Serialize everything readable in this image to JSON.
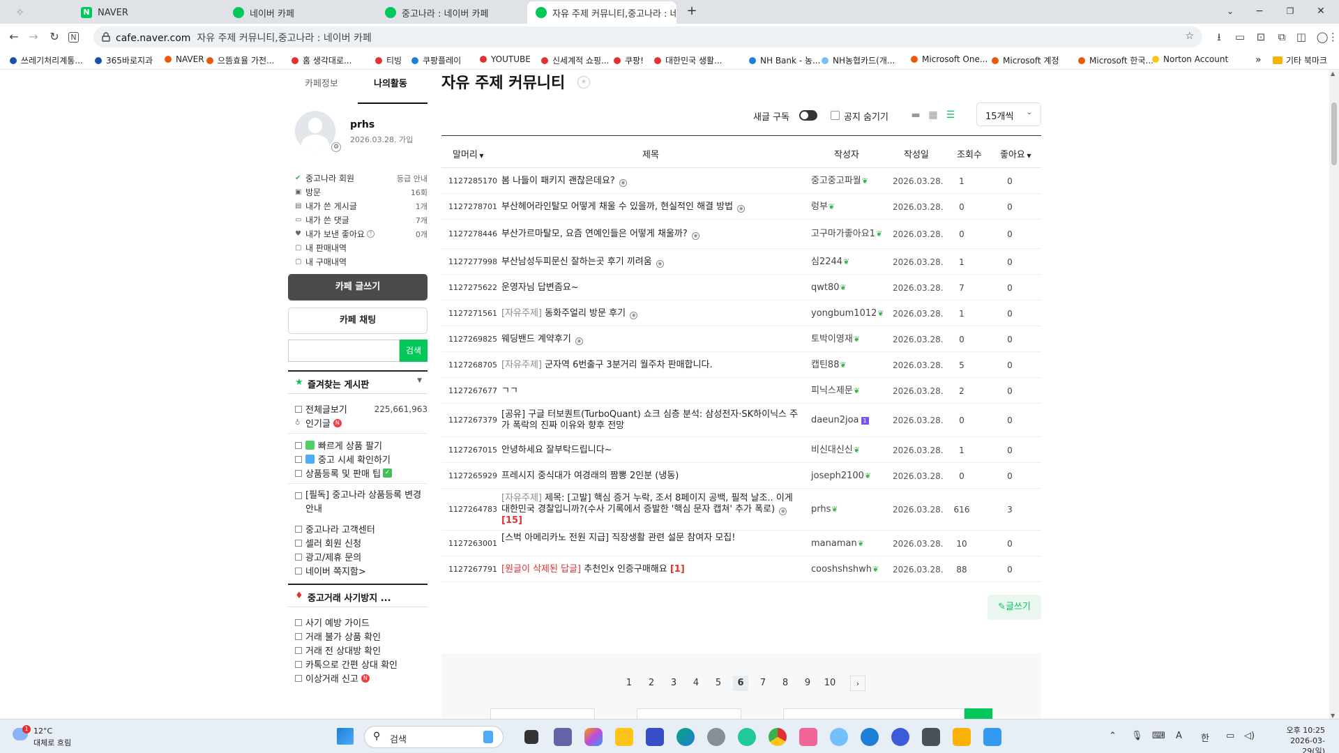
{
  "browser": {
    "tabs": [
      {
        "label": "NAVER",
        "favicon_color": "#03c75a",
        "favicon_letter": "N"
      },
      {
        "label": "네이버 카페",
        "favicon_color": "#03c75a",
        "favicon_letter": ""
      },
      {
        "label": "중고나라 : 네이버 카페",
        "favicon_color": "#03c75a",
        "favicon_letter": ""
      },
      {
        "label": "자유 주제 커뮤니티,중고나라 : 네",
        "favicon_color": "#03c75a",
        "favicon_letter": ""
      }
    ],
    "new_tab": "+",
    "address": {
      "host": "cafe.naver.com",
      "rest": "자유 주제 커뮤니티,중고나라 : 네이버 카페"
    },
    "bookmarks": [
      {
        "label": "쓰레기처리계통...",
        "color": "#1c4fa8"
      },
      {
        "label": "365바로지과",
        "color": "#1c4fa8"
      },
      {
        "label": "NAVER",
        "color": "#e8590c"
      },
      {
        "label": "으뜸효율 가전...",
        "color": "#e8590c"
      },
      {
        "label": "홈 생각대로...",
        "color": "#e03131"
      },
      {
        "label": "티빙",
        "color": "#e03131"
      },
      {
        "label": "쿠팡플레이",
        "color": "#1c7ed6"
      },
      {
        "label": "YOUTUBE",
        "color": "#e03131"
      },
      {
        "label": "신세계적 쇼핑...",
        "color": "#e03131"
      },
      {
        "label": "쿠팡!",
        "color": "#e03131"
      },
      {
        "label": "대한민국 생활...",
        "color": "#e03131"
      },
      {
        "label": "NH Bank - 농...",
        "color": "#1c7ed6"
      },
      {
        "label": "NH농협카드(개...",
        "color": "#74c0fc"
      },
      {
        "label": "Microsoft One...",
        "color": "#e8590c"
      },
      {
        "label": "Microsoft 계정",
        "color": "#e8590c"
      },
      {
        "label": "Microsoft 한국...",
        "color": "#e8590c"
      },
      {
        "label": "Norton Account",
        "color": "#fcc419"
      }
    ],
    "bookmarks_more": "»",
    "other_bookmarks": "기타 북마크"
  },
  "sidebar": {
    "tab_info": "카페정보",
    "tab_activity": "나의활동",
    "profile": {
      "name": "prhs",
      "joined": "2026.03.28. 가입"
    },
    "member_label": "중고나라 회원",
    "grade_link": "등급 안내",
    "stats": [
      {
        "label": "방문",
        "value": "16회"
      },
      {
        "label": "내가 쓴 게시글",
        "value": "1개"
      },
      {
        "label": "내가 쓴 댓글",
        "value": "7개"
      },
      {
        "label": "내가 보낸 좋아요",
        "value": "0개"
      },
      {
        "label": "내 판매내역",
        "value": ""
      },
      {
        "label": "내 구매내역",
        "value": ""
      }
    ],
    "write_button": "카페 글쓰기",
    "chat_button": "카페 채팅",
    "search_button": "검색",
    "favorites_title": "즐겨찾는 게시판",
    "all_posts": "전체글보기",
    "all_posts_count": "225,661,963",
    "popular": "인기글",
    "menu_group1": [
      "빠르게 상품 팔기",
      "중고 시세 확인하기",
      "상품등록 및 판매 팁"
    ],
    "menu_group2": [
      "[필독] 중고나라 상품등록 변경안내",
      "중고나라 고객센터",
      "셀러 회원 신청",
      "광고/제휴 문의",
      "네이버 쪽지함>"
    ],
    "fraud_title": "중고거래 사기방지 ...",
    "fraud_items": [
      "사기 예방 가이드",
      "거래 불가 상품 확인",
      "거래 전 상대방 확인",
      "카톡으로 간편 상대 확인",
      "이상거래 신고"
    ]
  },
  "main": {
    "title": "자유 주제 커뮤니티",
    "subscribe_label": "새글 구독",
    "hide_notice_label": "공지 숨기기",
    "per_page": "15개씩",
    "columns": {
      "prefix": "말머리",
      "title": "제목",
      "author": "작성자",
      "date": "작성일",
      "views": "조회수",
      "likes": "좋아요"
    },
    "rows": [
      {
        "no": "1127285170",
        "head": "",
        "title": "봄 나들이 패키지 괜찮은데요?",
        "emo": true,
        "count": "",
        "author": "중고중고파월",
        "date": "2026.03.28.",
        "views": "1",
        "likes": "0"
      },
      {
        "no": "1127278701",
        "head": "",
        "title": "부산헤어라인탈모 어떻게 채울 수 있을까, 현실적인 해결 방법",
        "emo": true,
        "count": "",
        "author": "렁부",
        "date": "2026.03.28.",
        "views": "0",
        "likes": "0"
      },
      {
        "no": "1127278446",
        "head": "",
        "title": "부산가르마탈모, 요즘 연예인들은 어떻게 채울까?",
        "emo": true,
        "count": "",
        "author": "고구마가좋아요1",
        "date": "2026.03.28.",
        "views": "0",
        "likes": "0"
      },
      {
        "no": "1127277998",
        "head": "",
        "title": "부산남성두피문신 잘하는곳 후기 끼려움",
        "emo": true,
        "count": "",
        "author": "심2244",
        "date": "2026.03.28.",
        "views": "1",
        "likes": "0"
      },
      {
        "no": "1127275622",
        "head": "",
        "title": "운영자님 답변좀요~",
        "emo": false,
        "count": "",
        "author": "qwt80",
        "date": "2026.03.28.",
        "views": "7",
        "likes": "0"
      },
      {
        "no": "1127271561",
        "head": "[자유주제]",
        "title": "동화주얼리 방문 후기",
        "emo": true,
        "count": "",
        "author": "yongbum1012",
        "date": "2026.03.28.",
        "views": "1",
        "likes": "0"
      },
      {
        "no": "1127269825",
        "head": "",
        "title": "웨딩밴드 계약후기",
        "emo": true,
        "count": "",
        "author": "토박이영재",
        "date": "2026.03.28.",
        "views": "0",
        "likes": "0"
      },
      {
        "no": "1127268705",
        "head": "[자유주제]",
        "title": "군자역 6번출구 3분거리 월주차 판매합니다.",
        "emo": false,
        "count": "",
        "author": "캡틴88",
        "date": "2026.03.28.",
        "views": "5",
        "likes": "0"
      },
      {
        "no": "1127267677",
        "head": "",
        "title": "ㄱㄱ",
        "emo": false,
        "count": "",
        "author": "피닉스제문",
        "date": "2026.03.28.",
        "views": "2",
        "likes": "0"
      },
      {
        "no": "1127267379",
        "head": "",
        "title": "[공유] 구글 터보퀀트(TurboQuant) 쇼크 심층 분석: 삼성전자·SK하이닉스 주가 폭락의 진짜 이유와 향후 전망",
        "emo": false,
        "count": "",
        "author": "daeun2joa",
        "date": "2026.03.28.",
        "views": "0",
        "likes": "0"
      },
      {
        "no": "1127267015",
        "head": "",
        "title": "안녕하세요 잘부탁드립니다~",
        "emo": false,
        "count": "",
        "author": "비신대신신",
        "date": "2026.03.28.",
        "views": "1",
        "likes": "0"
      },
      {
        "no": "1127265929",
        "head": "",
        "title": "프레시지 중식대가 여경래의 짬뽕 2인분 (냉동)",
        "emo": false,
        "count": "",
        "author": "joseph2100",
        "date": "2026.03.28.",
        "views": "0",
        "likes": "0"
      },
      {
        "no": "1127264783",
        "head": "[자유주제]",
        "title": "제목: [고발] 핵심 증거 누락, 조서 8페이지 공백, 필적 날조.. 이게 대한민국 경찰입니까?(수사 기록에서 증발한 '핵심 문자 캡쳐' 추가 폭로)",
        "emo": true,
        "count": "[15]",
        "author": "prhs",
        "date": "2026.03.28.",
        "views": "616",
        "likes": "3"
      },
      {
        "no": "1127263001",
        "head": "",
        "title": "[스벅 아메리카노 전원 지급] 직장생활 관련 설문 참여자 모집!",
        "emo": false,
        "count": "",
        "author": "manaman",
        "date": "2026.03.28.",
        "views": "10",
        "likes": "0"
      },
      {
        "no": "1127267791",
        "head": "[원글이 삭제된 답글]",
        "title": "추천인x 인증구매해요",
        "emo": false,
        "count": "[1]",
        "author": "cooshshshwh",
        "date": "2026.03.28.",
        "views": "88",
        "likes": "0"
      }
    ],
    "write_button": "✎글쓰기",
    "pages": [
      "1",
      "2",
      "3",
      "4",
      "5",
      "6",
      "7",
      "8",
      "9",
      "10"
    ],
    "current_page": "6",
    "next": "›"
  },
  "taskbar": {
    "weather_temp": "12°C",
    "weather_desc": "대체로 흐림",
    "weather_badge": "1",
    "search_placeholder": "검색",
    "clock_time": "오후 10:25",
    "clock_date": "2026-03-29(일)",
    "ime_a": "A",
    "ime_han": "한"
  }
}
